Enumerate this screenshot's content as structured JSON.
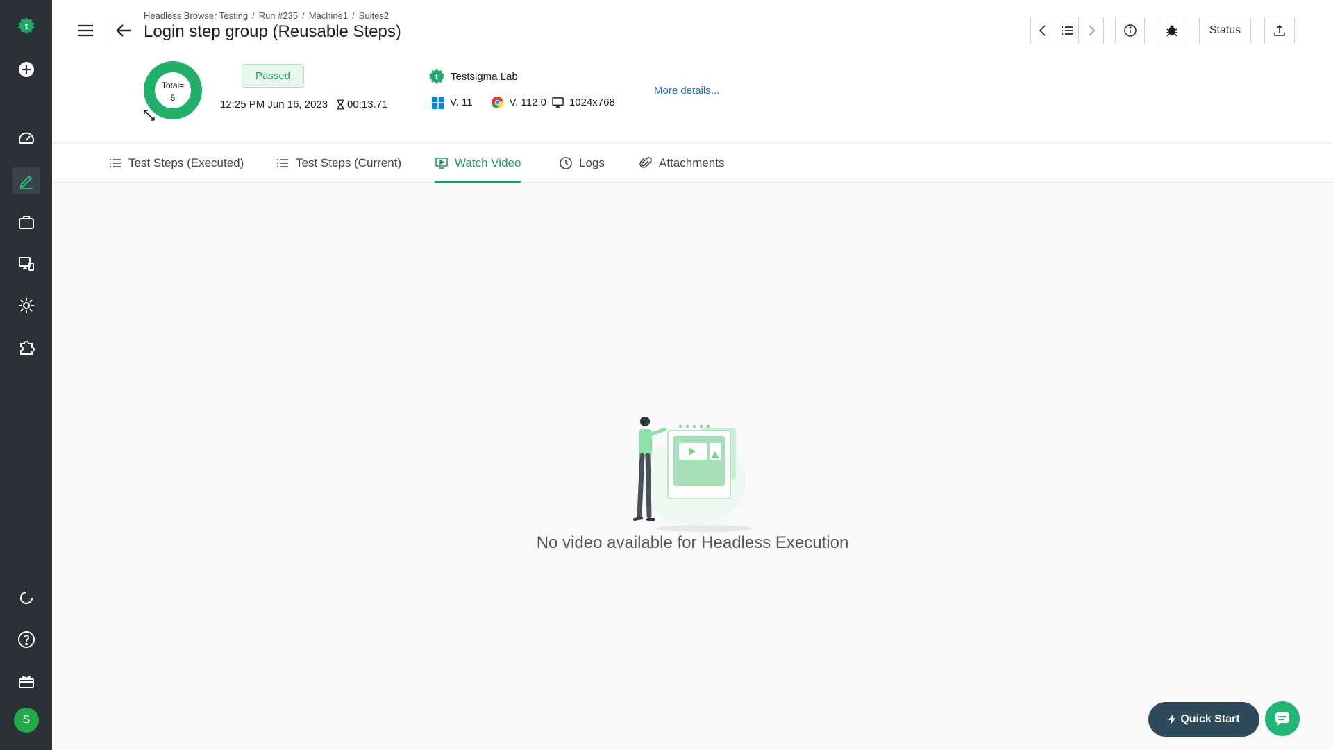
{
  "breadcrumb": [
    "Headless Browser Testing",
    "Run #235",
    "Machine1",
    "Suites2"
  ],
  "title": "Login step group (Reusable Steps)",
  "summary": {
    "total_label": "Total=",
    "total_value": "5",
    "passed_fraction": 1.0,
    "status": "Passed",
    "datetime": "12:25 PM Jun 16, 2023",
    "duration": "00:13.71",
    "lab": "Testsigma Lab",
    "os_version": "V. 11",
    "browser_version": "V. 112.0",
    "resolution": "1024x768",
    "more_details": "More details..."
  },
  "toolbar": {
    "status_label": "Status"
  },
  "tabs": [
    {
      "label": "Test Steps (Executed)",
      "icon": "list-icon"
    },
    {
      "label": "Test Steps (Current)",
      "icon": "list-icon"
    },
    {
      "label": "Watch Video",
      "icon": "video-icon",
      "active": true
    },
    {
      "label": "Logs",
      "icon": "clock-icon"
    },
    {
      "label": "Attachments",
      "icon": "paperclip-icon"
    }
  ],
  "empty_state": {
    "message": "No video available for Headless Execution"
  },
  "quick_start": "Quick Start",
  "user": {
    "initial": "S"
  },
  "colors": {
    "accent": "#1a9e5c",
    "rail": "#2b3137",
    "passed": "#22a35a"
  }
}
